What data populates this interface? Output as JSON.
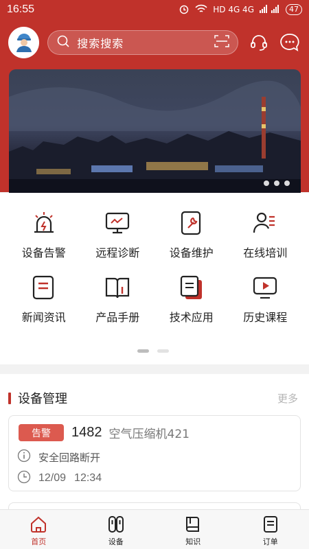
{
  "status_bar": {
    "time": "16:55",
    "indicators": "HD  4G  4G",
    "battery": "47"
  },
  "header": {
    "search_placeholder": "搜索搜索",
    "icons": [
      "avatar-worker-icon",
      "search-icon",
      "scan-icon",
      "headset-icon",
      "chat-icon"
    ]
  },
  "banner": {
    "slide_count": 3
  },
  "grid": {
    "items": [
      {
        "label": "设备告警",
        "icon": "alarm-icon"
      },
      {
        "label": "远程诊断",
        "icon": "monitor-icon"
      },
      {
        "label": "设备维护",
        "icon": "wrench-icon"
      },
      {
        "label": "在线培训",
        "icon": "trainer-icon"
      },
      {
        "label": "新闻资讯",
        "icon": "news-icon"
      },
      {
        "label": "产品手册",
        "icon": "book-icon"
      },
      {
        "label": "技术应用",
        "icon": "docs-icon"
      },
      {
        "label": "历史课程",
        "icon": "play-screen-icon"
      }
    ]
  },
  "device_section": {
    "title": "设备管理",
    "more": "更多",
    "card": {
      "badge": "告警",
      "number": "1482",
      "name": "空气压缩机421",
      "message": "安全回路断开",
      "date": "12/09",
      "time": "12:34"
    }
  },
  "bottom_nav": {
    "items": [
      {
        "label": "首页",
        "icon": "home-icon",
        "active": true
      },
      {
        "label": "设备",
        "icon": "device-icon"
      },
      {
        "label": "知识",
        "icon": "knowledge-icon"
      },
      {
        "label": "订单",
        "icon": "order-icon"
      }
    ]
  },
  "colors": {
    "brand_red": "#c0322b",
    "badge_red": "#dc5a4f",
    "icon_dark": "#222222"
  }
}
